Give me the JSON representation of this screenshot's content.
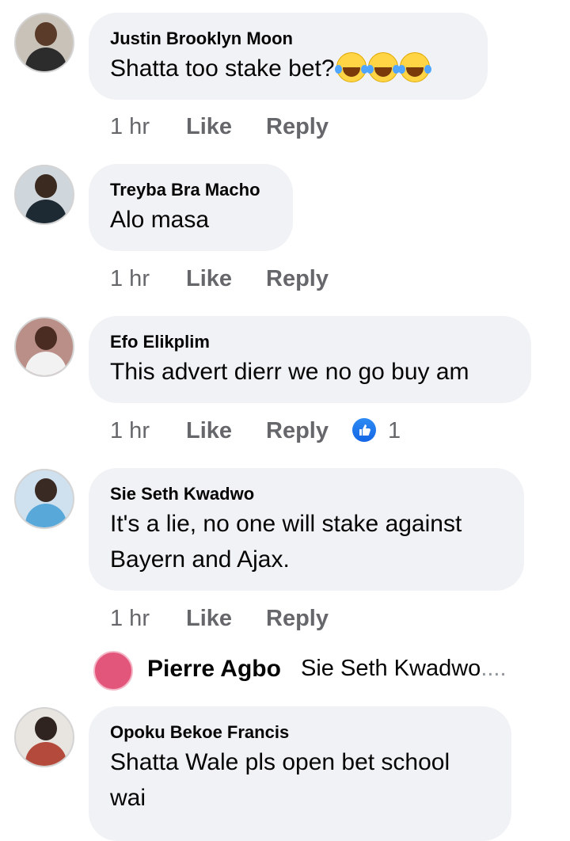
{
  "comments": [
    {
      "author": "Justin Brooklyn Moon",
      "lines": [
        "Shatta too stake bet?"
      ],
      "time": "1 hr",
      "like": "Like",
      "reply": "Reply"
    },
    {
      "author": "Treyba Bra Macho",
      "lines": [
        "Alo masa"
      ],
      "time": "1 hr",
      "like": "Like",
      "reply": "Reply"
    },
    {
      "author": "Efo Elikplim",
      "lines": [
        "This advert dierr we no go buy am"
      ],
      "time": "1 hr",
      "like": "Like",
      "reply": "Reply",
      "reaction_count": "1"
    },
    {
      "author": "Sie Seth Kwadwo",
      "lines": [
        "It's a lie, no one will stake against",
        "Bayern and Ajax."
      ],
      "time": "1 hr",
      "like": "Like",
      "reply": "Reply"
    },
    {
      "author": "Opoku Bekoe Francis",
      "lines": [
        "Shatta Wale pls open bet school",
        "wai"
      ]
    }
  ],
  "reply_preview": {
    "author": "Pierre Agbo",
    "text": "Sie Seth Kwadwo",
    "ellipsis": "...."
  },
  "colors": {
    "bubble": "#f0f2f5",
    "meta": "#65676b",
    "like_reaction": "#1877f2"
  }
}
